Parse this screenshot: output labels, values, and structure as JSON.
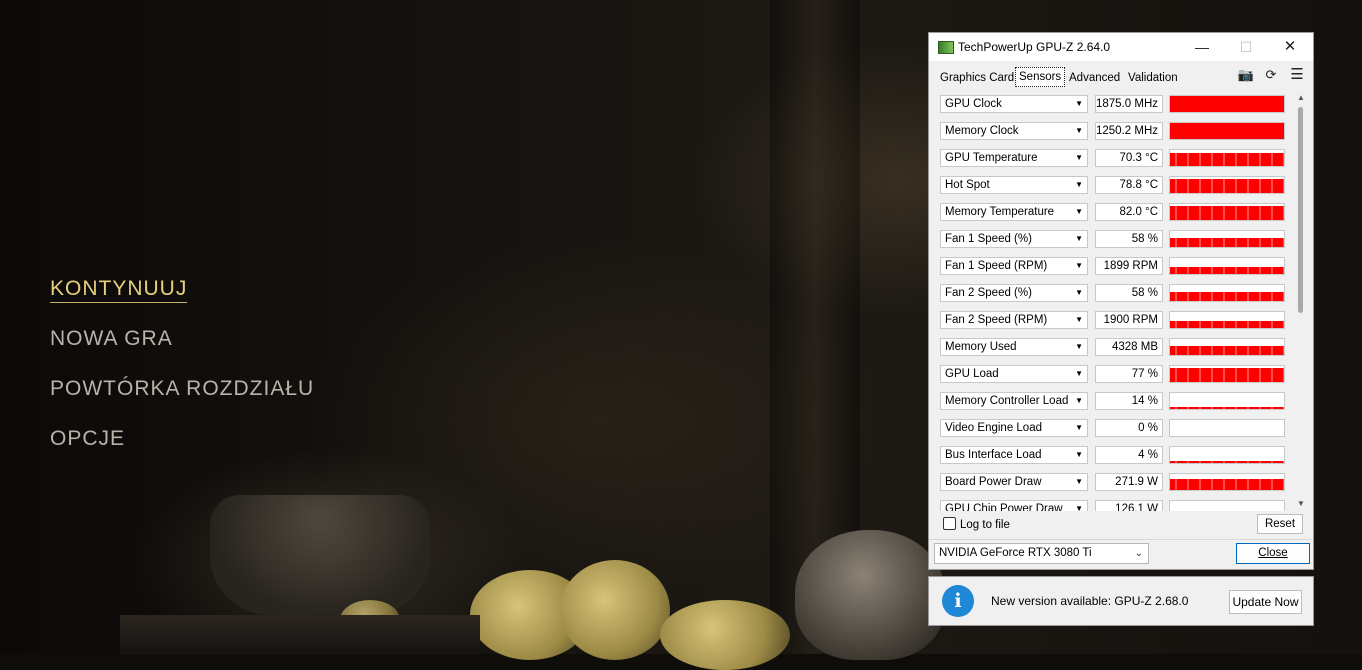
{
  "game_menu": {
    "items": [
      {
        "label": "KONTYNUUJ",
        "active": true
      },
      {
        "label": "NOWA GRA",
        "active": false
      },
      {
        "label": "POWTÓRKA ROZDZIAŁU",
        "active": false
      },
      {
        "label": "OPCJE",
        "active": false
      }
    ],
    "active_color": "#e7cf7d",
    "inactive_color": "#b9b3aa"
  },
  "gpuz": {
    "title": "TechPowerUp GPU-Z 2.64.0",
    "window_controls": {
      "minimize": "—",
      "maximize": "☐",
      "close": "✕"
    },
    "tabs": [
      {
        "label": "Graphics Card",
        "selected": false
      },
      {
        "label": "Sensors",
        "selected": true
      },
      {
        "label": "Advanced",
        "selected": false
      },
      {
        "label": "Validation",
        "selected": false
      }
    ],
    "toolbar_icons": [
      "camera-icon",
      "refresh-icon",
      "menu-icon"
    ],
    "sensors": [
      {
        "name": "GPU Clock",
        "value": "1875.0 MHz",
        "level": 0.97
      },
      {
        "name": "Memory Clock",
        "value": "1250.2 MHz",
        "level": 0.97
      },
      {
        "name": "GPU Temperature",
        "value": "70.3 °C",
        "level": 0.8
      },
      {
        "name": "Hot Spot",
        "value": "78.8 °C",
        "level": 0.85
      },
      {
        "name": "Memory Temperature",
        "value": "82.0 °C",
        "level": 0.88
      },
      {
        "name": "Fan 1 Speed (%)",
        "value": "58 %",
        "level": 0.55
      },
      {
        "name": "Fan 1 Speed (RPM)",
        "value": "1899 RPM",
        "level": 0.45
      },
      {
        "name": "Fan 2 Speed (%)",
        "value": "58 %",
        "level": 0.55
      },
      {
        "name": "Fan 2 Speed (RPM)",
        "value": "1900 RPM",
        "level": 0.45
      },
      {
        "name": "Memory Used",
        "value": "4328 MB",
        "level": 0.55
      },
      {
        "name": "GPU Load",
        "value": "77 %",
        "level": 0.9
      },
      {
        "name": "Memory Controller Load",
        "value": "14 %",
        "level": 0.15
      },
      {
        "name": "Video Engine Load",
        "value": "0 %",
        "level": 0.0
      },
      {
        "name": "Bus Interface Load",
        "value": "4 %",
        "level": 0.1
      },
      {
        "name": "Board Power Draw",
        "value": "271.9 W",
        "level": 0.7
      },
      {
        "name": "GPU Chip Power Draw",
        "value": "126.1 W",
        "level": 0.35
      }
    ],
    "graph_color": "#ff0000",
    "log_to_file": {
      "label": "Log to file",
      "checked": false
    },
    "reset_label": "Reset",
    "gpu_select": "NVIDIA GeForce RTX 3080 Ti",
    "close_label": "Close"
  },
  "update_notice": {
    "message": "New version available: GPU-Z 2.68.0",
    "button": "Update Now",
    "icon": "info-icon"
  }
}
